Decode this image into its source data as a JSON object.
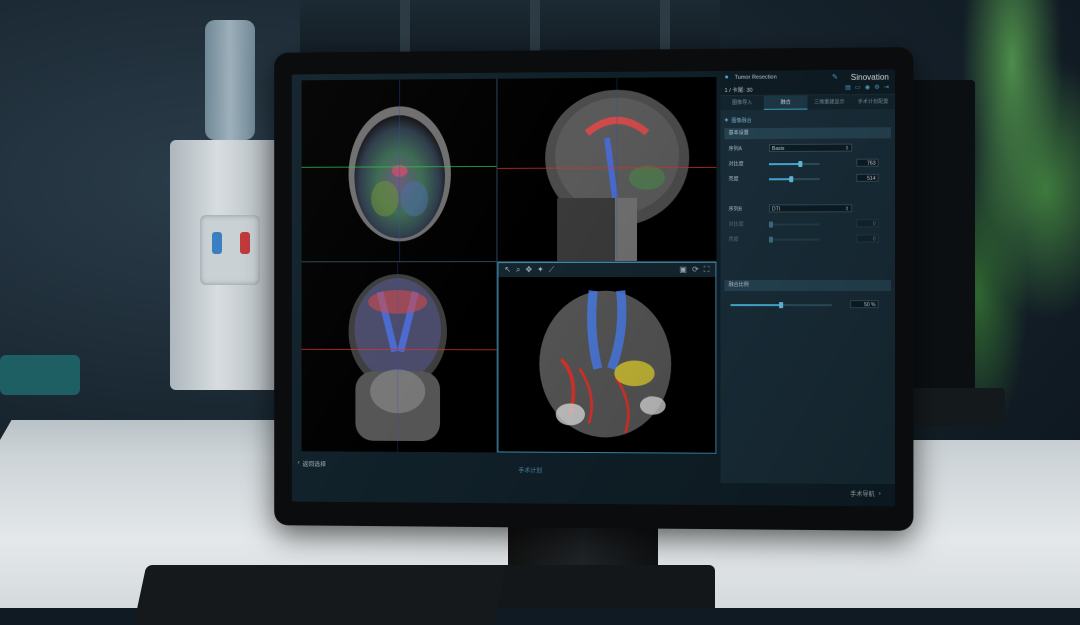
{
  "header": {
    "role": "Tumor Resection",
    "counter": "1 / 卡尾: 30",
    "brand": "Sinovation"
  },
  "tabs": [
    {
      "label": "图像导入"
    },
    {
      "label": "融合"
    },
    {
      "label": "三维重建显示"
    },
    {
      "label": "手术计划配置"
    }
  ],
  "panel": {
    "section_title": "图像融合",
    "subheader": "基本设置",
    "seq_a": {
      "label": "序列A",
      "value": "Basis"
    },
    "contrast_a": {
      "label": "对比度",
      "value": "763",
      "level": 0.62
    },
    "brightness_a": {
      "label": "亮度",
      "value": "514",
      "level": 0.45
    },
    "seq_b": {
      "label": "序列B",
      "value": "DTI"
    },
    "contrast_b": {
      "label": "对比度",
      "value": "0"
    },
    "brightness_b": {
      "label": "亮度",
      "value": "0"
    },
    "fusion": {
      "label": "融合比例",
      "value": "50 %",
      "level": 0.5
    }
  },
  "footer": {
    "back": "返回选择",
    "center": "手术计划",
    "next": "手术导航"
  },
  "colors": {
    "accent": "#49b5df",
    "panel": "#1a2f3b",
    "crosshair_green": "#2fbf4a",
    "crosshair_red": "#d8322a"
  }
}
